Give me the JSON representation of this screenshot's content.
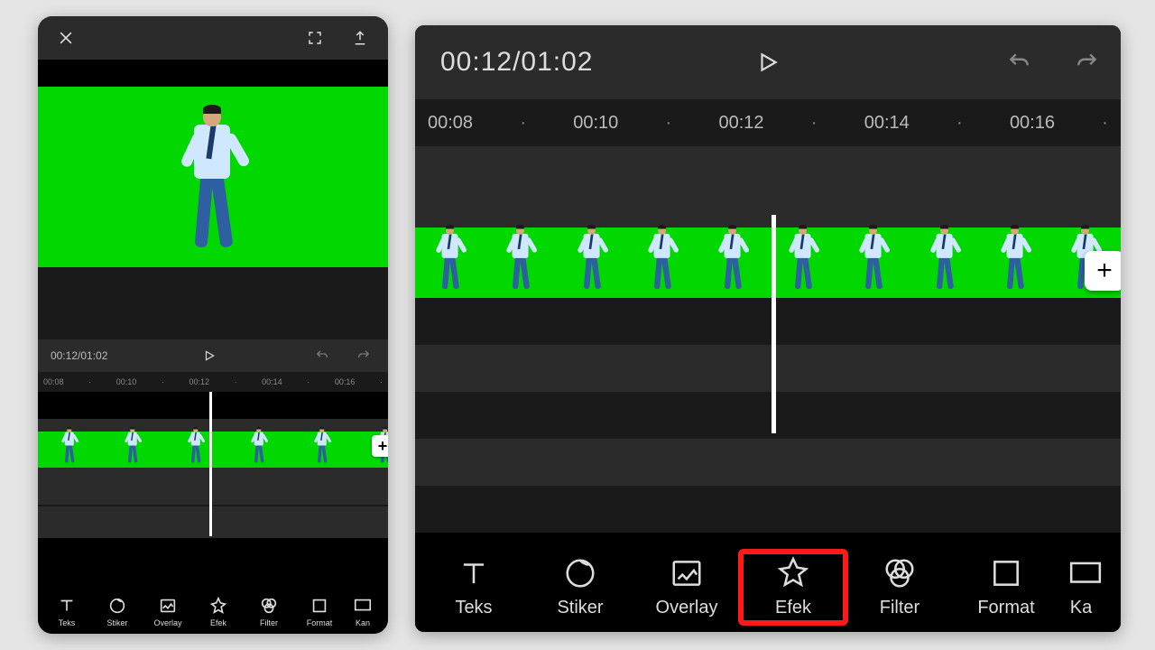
{
  "time_display": "00:12/01:02",
  "ruler_ticks": [
    "00:08",
    "·",
    "00:10",
    "·",
    "00:12",
    "·",
    "00:14",
    "·",
    "00:16",
    "·"
  ],
  "tools": [
    {
      "id": "teks",
      "label": "Teks"
    },
    {
      "id": "stiker",
      "label": "Stiker"
    },
    {
      "id": "overlay",
      "label": "Overlay"
    },
    {
      "id": "efek",
      "label": "Efek"
    },
    {
      "id": "filter",
      "label": "Filter"
    },
    {
      "id": "format",
      "label": "Format"
    },
    {
      "id": "kanvas",
      "label": "Kanvas",
      "truncated_right": "Ka",
      "truncated_left": "Kan"
    }
  ],
  "highlighted_tool": "efek",
  "add_label": "+",
  "colors": {
    "greenscreen": "#00d800",
    "highlight": "#ff1a1a"
  }
}
